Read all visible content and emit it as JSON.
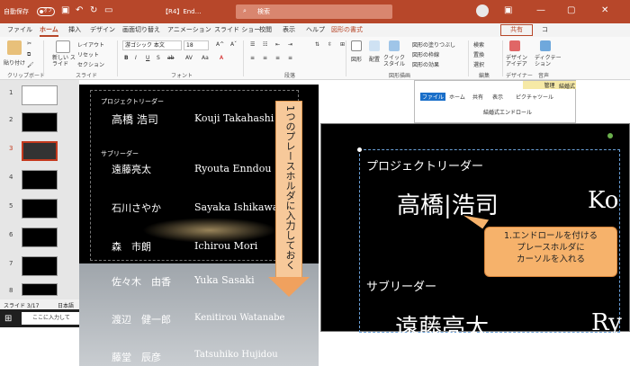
{
  "titlebar": {
    "autosave_label": "自動保存",
    "toggle_state": "オフ",
    "doc_title": "【R4】End…",
    "search_placeholder": "検索",
    "minimize": "—",
    "restore": "▢"
  },
  "ribbon_tabs": [
    "ファイル",
    "ホーム",
    "挿入",
    "デザイン",
    "画面切り替え",
    "アニメーション",
    "スライド ショー",
    "校閲",
    "表示",
    "ヘルプ",
    "図形の書式"
  ],
  "ribbon": {
    "share_label": "共有",
    "comment_label": "コ",
    "paste_label": "貼り付け",
    "new_slide_label": "新しい スライド",
    "layout_label": "レイアウト",
    "reset_label": "リセット",
    "section_label": "セクション",
    "font_name": "游ゴシック 本文",
    "font_size": "18",
    "clipboard_group": "クリップボード",
    "slides_group": "スライド",
    "font_group": "フォント",
    "paragraph_group": "段落",
    "drawing_group": "図形描画",
    "editing_group": "編集",
    "designer_group": "デザイナー",
    "voice_group": "音声",
    "shape_label": "図形",
    "arrange_label": "配置",
    "quick_style_label": "クイック スタイル",
    "fill_label": "図形の塗りつぶし",
    "outline_label": "図形の枠線",
    "effects_label": "図形の効果",
    "find_label": "検索",
    "replace_label": "置換",
    "select_label": "選択",
    "design_ideas_label": "デザイン アイデア",
    "dictate_label": "ディクテーション"
  },
  "thumbnails": [
    "1",
    "2",
    "3",
    "4",
    "5",
    "6",
    "7",
    "8"
  ],
  "slide": {
    "leader_heading": "プロジェクトリーダー",
    "sub_heading": "サブリーダー",
    "people": [
      {
        "jp": "高橋 浩司",
        "en": "Kouji Takahashi"
      },
      {
        "jp": "遠藤亮太",
        "en": "Ryouta Enndou"
      },
      {
        "jp": "石川さやか",
        "en": "Sayaka Ishikawa"
      },
      {
        "jp": "森　市朗",
        "en": "Ichirou Mori"
      },
      {
        "jp": "佐々木　由香",
        "en": "Yuka Sasaki"
      },
      {
        "jp": "渡辺　健一郎",
        "en": "Kenitirou Watanabe"
      },
      {
        "jp": "藤堂　辰彦",
        "en": "Tatsuhiko Hujidou"
      }
    ]
  },
  "callout_vertical": "1つのプレースホルダに入力しておく",
  "explorer": {
    "manage": "管理",
    "title": "結婚式",
    "tabs": [
      "ファイル",
      "ホーム",
      "共有",
      "表示",
      "ピクチャツール"
    ],
    "path": "結婚式エンドロール"
  },
  "zoom": {
    "leader_heading": "プロジェクトリーダー",
    "leader_name": "高橋|浩司",
    "ko": "Ko",
    "sub_heading": "サブリーダー",
    "sub_partial": "遠藤亮太",
    "ry": "Ry"
  },
  "callout2": [
    "1.エンドロールを付ける",
    "プレースホルダに",
    "カーソルを入れる"
  ],
  "status": {
    "slide": "スライド 3/17",
    "lang": "日本語"
  },
  "taskbar": {
    "search_placeholder": "ここに入力して"
  },
  "colors": {
    "accent": "#b7472a",
    "callout": "#f6b26b"
  }
}
